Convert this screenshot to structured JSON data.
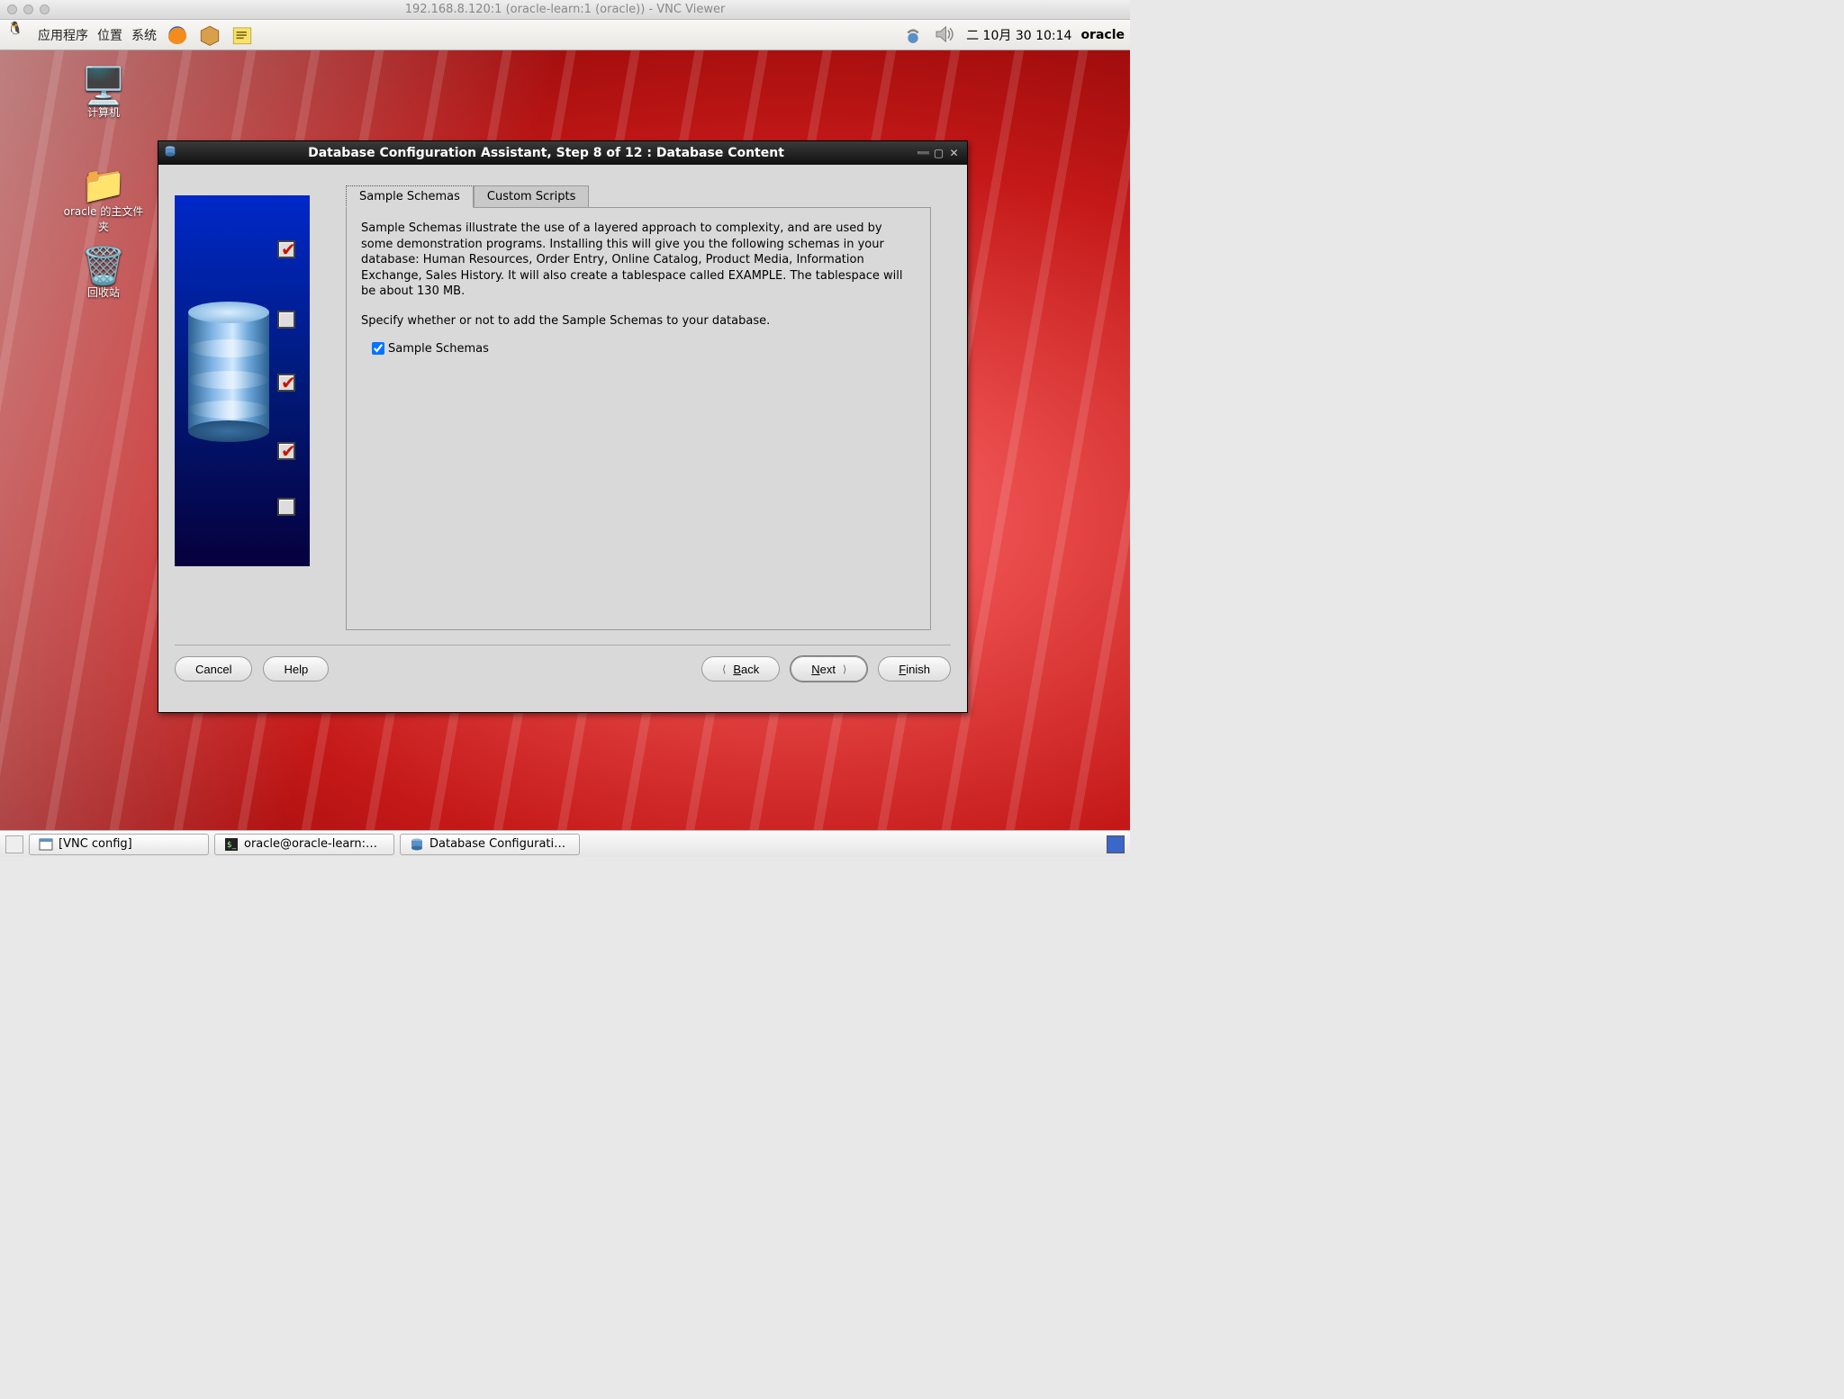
{
  "mac": {
    "title": "192.168.8.120:1 (oracle-learn:1 (oracle)) - VNC Viewer"
  },
  "panel": {
    "menu_apps": "应用程序",
    "menu_places": "位置",
    "menu_system": "系统",
    "clock": "二  10月  30 10:14",
    "user": "oracle"
  },
  "desktop_icons": {
    "computer": "计算机",
    "home": "oracle 的主文件夹",
    "trash": "回收站"
  },
  "dialog": {
    "title": "Database Configuration Assistant, Step 8 of 12 : Database Content",
    "tabs": {
      "sample": "Sample Schemas",
      "custom": "Custom Scripts"
    },
    "desc": "Sample Schemas illustrate the use of a layered approach to complexity, and are used by some demonstration programs. Installing this will give you the following schemas in your database: Human Resources, Order Entry, Online Catalog, Product Media, Information Exchange, Sales History. It will also create a tablespace called EXAMPLE. The tablespace will be about 130 MB.",
    "prompt": "Specify whether or not to add the Sample Schemas to your database.",
    "checkbox_label": "Sample Schemas",
    "buttons": {
      "cancel": "Cancel",
      "help": "Help",
      "back": "Back",
      "next": "Next",
      "finish": "Finish"
    }
  },
  "taskbar": {
    "vnc": "[VNC config]",
    "term": "oracle@oracle-learn:…",
    "dbca": "Database Configurati…"
  }
}
